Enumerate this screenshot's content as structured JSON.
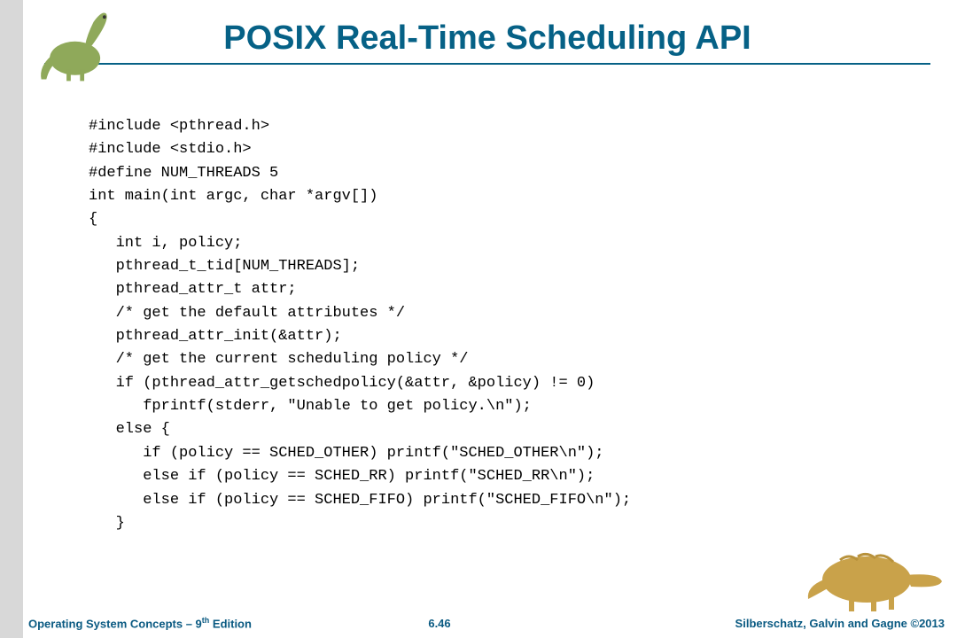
{
  "title": "POSIX Real-Time Scheduling API",
  "code": "#include <pthread.h>\n#include <stdio.h>\n#define NUM_THREADS 5\nint main(int argc, char *argv[])\n{\n   int i, policy;\n   pthread_t_tid[NUM_THREADS];\n   pthread_attr_t attr;\n   /* get the default attributes */\n   pthread_attr_init(&attr);\n   /* get the current scheduling policy */\n   if (pthread_attr_getschedpolicy(&attr, &policy) != 0)\n      fprintf(stderr, \"Unable to get policy.\\n\");\n   else {\n      if (policy == SCHED_OTHER) printf(\"SCHED_OTHER\\n\");\n      else if (policy == SCHED_RR) printf(\"SCHED_RR\\n\");\n      else if (policy == SCHED_FIFO) printf(\"SCHED_FIFO\\n\");\n   }",
  "footer": {
    "left_prefix": "Operating System Concepts – 9",
    "left_suffix": " Edition",
    "left_sup": "th",
    "center": "6.46",
    "right": "Silberschatz, Galvin and Gagne ©2013"
  }
}
